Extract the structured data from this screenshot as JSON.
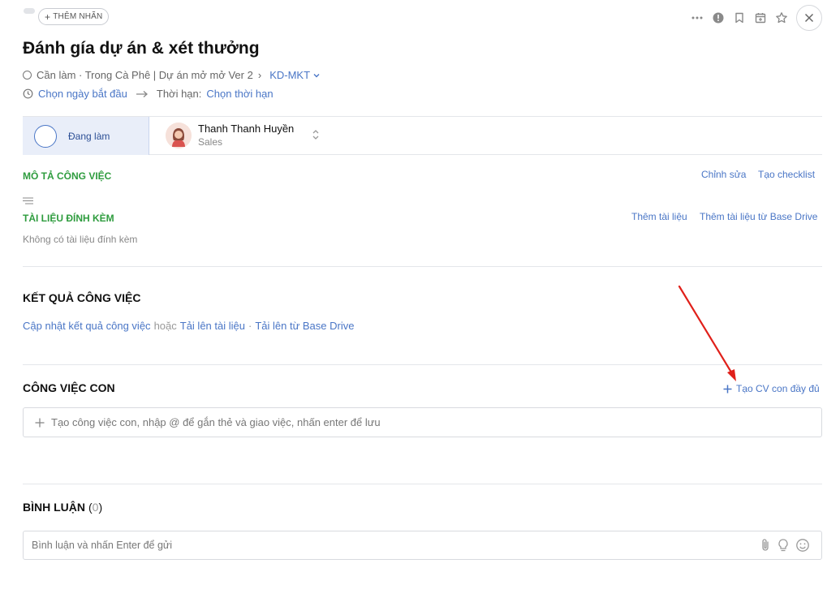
{
  "header": {
    "add_tag_label": "THÊM NHÃN",
    "title": "Đánh gía dự án & xét thưởng",
    "meta_text": "Cần làm · Trong Cà Phê | Dự án mở mở Ver 2",
    "meta_separator": "›",
    "dept": "KD-MKT",
    "start_date_link": "Chọn ngày bắt đầu",
    "deadline_label": "Thời hạn:",
    "deadline_link": "Chọn thời hạn"
  },
  "toolbar_icons": [
    "more-icon",
    "alert-icon",
    "bookmark-icon",
    "calendar-icon",
    "star-icon",
    "close-icon"
  ],
  "status": {
    "label": "Đang làm",
    "assignee_name": "Thanh Thanh Huyền",
    "assignee_role": "Sales"
  },
  "description": {
    "title": "MÔ TẢ CÔNG VIỆC",
    "edit_link": "Chỉnh sửa",
    "checklist_link": "Tạo checklist"
  },
  "attachments": {
    "title": "TÀI LIỆU ĐÍNH KÈM",
    "add_link": "Thêm tài liệu",
    "add_drive_link": "Thêm tài liệu từ Base Drive",
    "empty_text": "Không có tài liệu đính kèm"
  },
  "results": {
    "title": "KẾT QUẢ CÔNG VIỆC",
    "update_link": "Cập nhật kết quả công việc",
    "or_text": "hoặc",
    "upload_link": "Tải lên tài liệu",
    "dot": "·",
    "drive_link": "Tải lên từ Base Drive"
  },
  "subtasks": {
    "title": "CÔNG VIỆC CON",
    "create_full_link": "Tạo CV con đầy đủ",
    "input_placeholder": "Tạo công việc con, nhập @ để gắn thẻ và giao việc, nhấn enter để lưu"
  },
  "comments": {
    "title": "BÌNH LUẬN",
    "count_open": "(",
    "count": "0",
    "count_close": ")",
    "input_placeholder": "Bình luận và nhấn Enter để gửi"
  },
  "colors": {
    "link": "#4a76c6",
    "section_green": "#2e9c3e",
    "annotation_arrow": "#e0201a"
  }
}
